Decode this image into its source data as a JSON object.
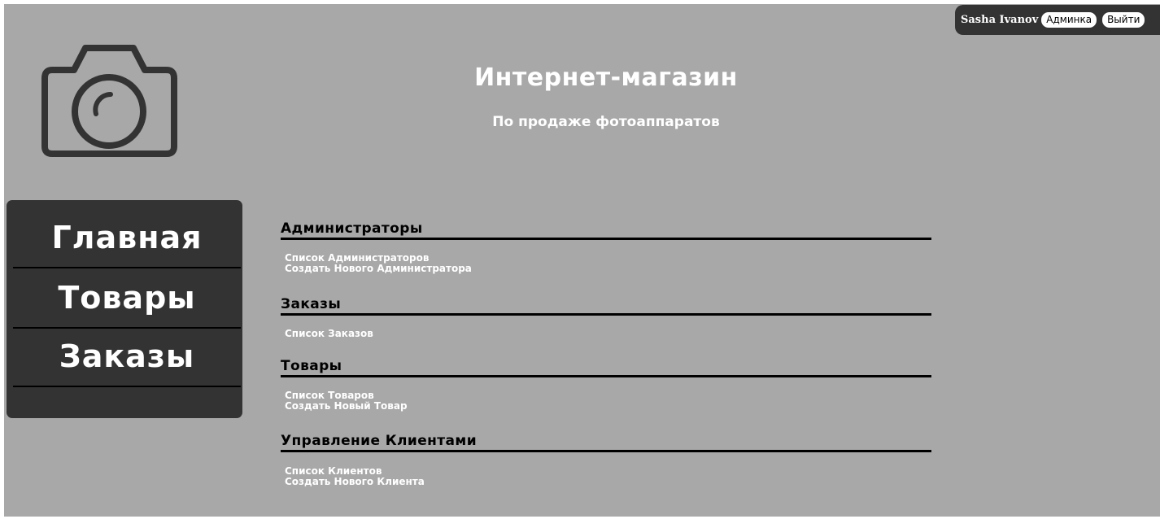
{
  "user": {
    "name": "Sasha Ivanov",
    "admin_label": "Админка",
    "logout_label": "Выйти"
  },
  "header": {
    "title": "Интернет-магазин",
    "subtitle": "По продаже фотоаппаратов",
    "logo_icon": "camera-icon"
  },
  "nav": {
    "items": [
      {
        "label": "Главная"
      },
      {
        "label": "Товары"
      },
      {
        "label": "Заказы"
      }
    ]
  },
  "sections": [
    {
      "title": "Администраторы",
      "links": [
        "Список Администраторов",
        "Создать Нового Администратора"
      ]
    },
    {
      "title": "Заказы",
      "links": [
        "Список Заказов"
      ]
    },
    {
      "title": "Товары",
      "links": [
        "Список Товаров",
        "Создать Новый Товар"
      ]
    },
    {
      "title": "Управление Клиентами",
      "links": [
        "Список Клиентов",
        "Создать Нового Клиента"
      ]
    }
  ],
  "colors": {
    "background": "#a8a8a8",
    "panel": "#333333",
    "text_light": "#ffffff",
    "text_dark": "#000000"
  }
}
